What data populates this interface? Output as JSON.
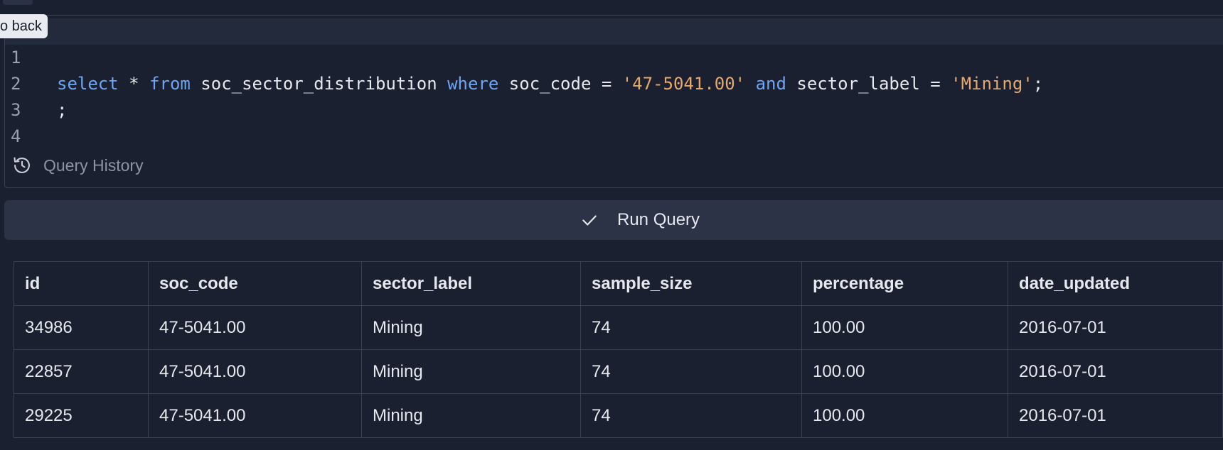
{
  "tooltip": {
    "label": "o back"
  },
  "editor": {
    "lines": [
      {
        "number": "1",
        "tokens": [
          {
            "t": "select",
            "c": "kw"
          },
          {
            "t": " * ",
            "c": "plain"
          },
          {
            "t": "from",
            "c": "kw"
          },
          {
            "t": " soc_sector_distribution ",
            "c": "plain"
          },
          {
            "t": "where",
            "c": "kw"
          },
          {
            "t": " soc_code = ",
            "c": "plain"
          },
          {
            "t": "'47-5041.00'",
            "c": "str"
          },
          {
            "t": " ",
            "c": "plain"
          },
          {
            "t": "and",
            "c": "kw"
          },
          {
            "t": " sector_label = ",
            "c": "plain"
          },
          {
            "t": "'Mining'",
            "c": "str"
          },
          {
            "t": ";",
            "c": "plain"
          }
        ]
      },
      {
        "number": "2",
        "tokens": [
          {
            "t": ";",
            "c": "plain"
          }
        ]
      },
      {
        "number": "3",
        "tokens": []
      },
      {
        "number": "4",
        "tokens": []
      }
    ],
    "query_history_label": "Query History"
  },
  "run_button": {
    "label": "Run Query"
  },
  "results": {
    "columns": [
      "id",
      "soc_code",
      "sector_label",
      "sample_size",
      "percentage",
      "date_updated"
    ],
    "rows": [
      [
        "34986",
        "47-5041.00",
        "Mining",
        "74",
        "100.00",
        "2016-07-01"
      ],
      [
        "22857",
        "47-5041.00",
        "Mining",
        "74",
        "100.00",
        "2016-07-01"
      ],
      [
        "29225",
        "47-5041.00",
        "Mining",
        "74",
        "100.00",
        "2016-07-01"
      ]
    ]
  },
  "colors": {
    "background": "#1b2030",
    "keyword": "#6ea4f4",
    "string": "#e6a96b",
    "button": "#2d3346",
    "border": "#3a4052"
  },
  "icons": {
    "history": "history-icon",
    "check": "check-icon"
  }
}
